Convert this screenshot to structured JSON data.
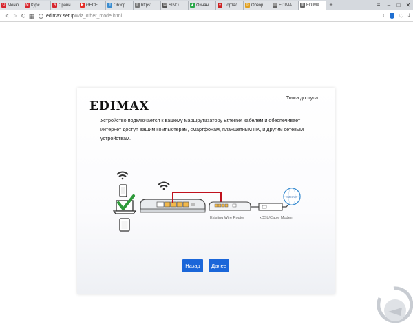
{
  "browser": {
    "tabs": [
      {
        "label": "Меню",
        "fav_color": "#d7262e",
        "fav_glyph": "O"
      },
      {
        "label": "Курс",
        "fav_color": "#d7262e",
        "fav_glyph": "M"
      },
      {
        "label": "Сравн",
        "fav_color": "#d7262e",
        "fav_glyph": "A"
      },
      {
        "label": "GECE",
        "fav_color": "#e52d27",
        "fav_glyph": "▶"
      },
      {
        "label": "Обзор",
        "fav_color": "#3a8dd1",
        "fav_glyph": "e"
      },
      {
        "label": "https:",
        "fav_color": "#777777",
        "fav_glyph": "≡"
      },
      {
        "label": "SINO",
        "fav_color": "#555555",
        "fav_glyph": "▤"
      },
      {
        "label": "Финан",
        "fav_color": "#2aa84a",
        "fav_glyph": "▲"
      },
      {
        "label": "Портал",
        "fav_color": "#cc2222",
        "fav_glyph": "●"
      },
      {
        "label": "Обзор",
        "fav_color": "#e0a020",
        "fav_glyph": "◎"
      },
      {
        "label": "EDIMA",
        "fav_color": "#666666",
        "fav_glyph": "▥"
      },
      {
        "label": "EDIMA",
        "fav_color": "#666666",
        "fav_glyph": "▥"
      }
    ],
    "active_tab_index": 11,
    "new_tab_glyph": "+",
    "url_host": "edimax.setup",
    "url_path": "/wiz_other_mode.html",
    "badge_count": "0"
  },
  "wizard": {
    "logo": "EDIMAX",
    "mode_title": "Точка доступа",
    "description": "Устройство подключается к вашему маршрутизатору Ethernet кабелем и обеспечивает интернет доступ вашим компьютерам, смартфонам, планшетным ПК, и другим сетевым устройствам.",
    "diagram": {
      "router_label": "Existing Wire Router",
      "modem_label": "xDSL/Cable Modem",
      "internet_label": "Internet"
    },
    "back_button": "Назад",
    "next_button": "Далее"
  },
  "colors": {
    "button": "#1a66d9",
    "cable": "#c0121e",
    "check": "#2e9a3a"
  }
}
